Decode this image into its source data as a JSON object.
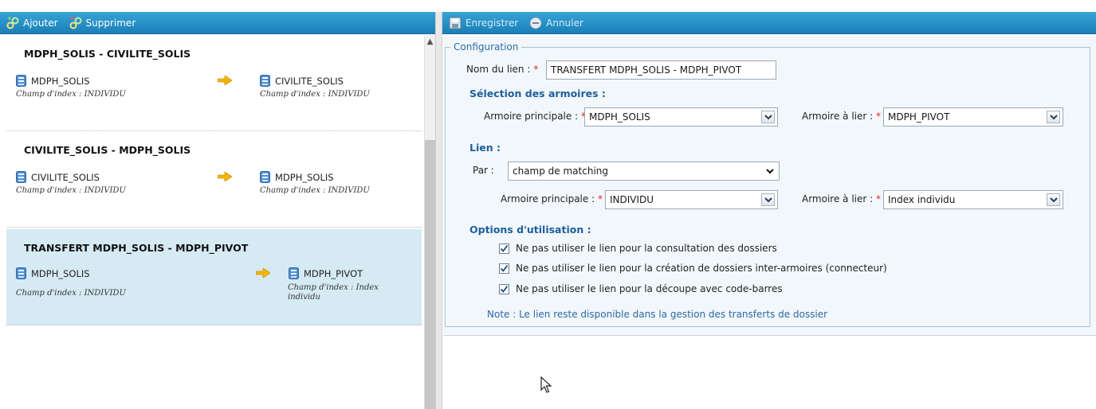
{
  "left_toolbar": {
    "add_label": "Ajouter",
    "delete_label": "Supprimer"
  },
  "right_toolbar": {
    "save_label": "Enregistrer",
    "cancel_label": "Annuler"
  },
  "links": [
    {
      "title": "MDPH_SOLIS - CIVILITE_SOLIS",
      "source": {
        "name": "MDPH_SOLIS",
        "champ": "Champ d'index : INDIVIDU"
      },
      "target": {
        "name": "CIVILITE_SOLIS",
        "champ": "Champ d'index : INDIVIDU"
      },
      "selected": false
    },
    {
      "title": "CIVILITE_SOLIS - MDPH_SOLIS",
      "source": {
        "name": "CIVILITE_SOLIS",
        "champ": "Champ d'index : INDIVIDU"
      },
      "target": {
        "name": "MDPH_SOLIS",
        "champ": "Champ d'index : INDIVIDU"
      },
      "selected": false
    },
    {
      "title": "TRANSFERT MDPH_SOLIS - MDPH_PIVOT",
      "source": {
        "name": "MDPH_SOLIS",
        "champ": "Champ d'index : INDIVIDU"
      },
      "target": {
        "name": "MDPH_PIVOT",
        "champ": "Champ d'index : Index individu"
      },
      "selected": true
    }
  ],
  "config": {
    "legend": "Configuration",
    "nom_label": "Nom du lien :",
    "nom_value": "TRANSFERT MDPH_SOLIS - MDPH_PIVOT",
    "required_marker": "*",
    "selection_title": "Sélection des armoires :",
    "armoire_principale_label": "Armoire principale :",
    "armoire_principale_value": "MDPH_SOLIS",
    "armoire_lier_label": "Armoire à lier :",
    "armoire_lier_value": "MDPH_PIVOT",
    "lien_title": "Lien :",
    "par_label": "Par :",
    "par_value": "champ de matching",
    "lien_principale_label": "Armoire principale :",
    "lien_principale_value": "INDIVIDU",
    "lien_lier_label": "Armoire à lier :",
    "lien_lier_value": "Index individu",
    "options_title": "Options d'utilisation :",
    "options": [
      {
        "label": "Ne pas utiliser le lien pour la consultation des dossiers",
        "checked": true
      },
      {
        "label": "Ne pas utiliser le lien pour la création de dossiers inter-armoires (connecteur)",
        "checked": true
      },
      {
        "label": "Ne pas utiliser le lien pour la découpe avec code-barres",
        "checked": true
      }
    ],
    "note": "Note : Le lien reste disponible dans la gestion des transferts de dossier"
  },
  "colors": {
    "toolbar": "#1a7fb8",
    "section_title": "#1c5f9b",
    "selected_row": "#d5eaf3",
    "required": "#e0252a",
    "arrow": "#f5b400"
  },
  "icons": [
    "link-add-icon",
    "link-delete-icon",
    "save-icon",
    "cancel-icon",
    "database-icon",
    "arrow-right-icon",
    "chevron-down-icon",
    "checkmark-icon",
    "mouse-cursor-icon"
  ]
}
